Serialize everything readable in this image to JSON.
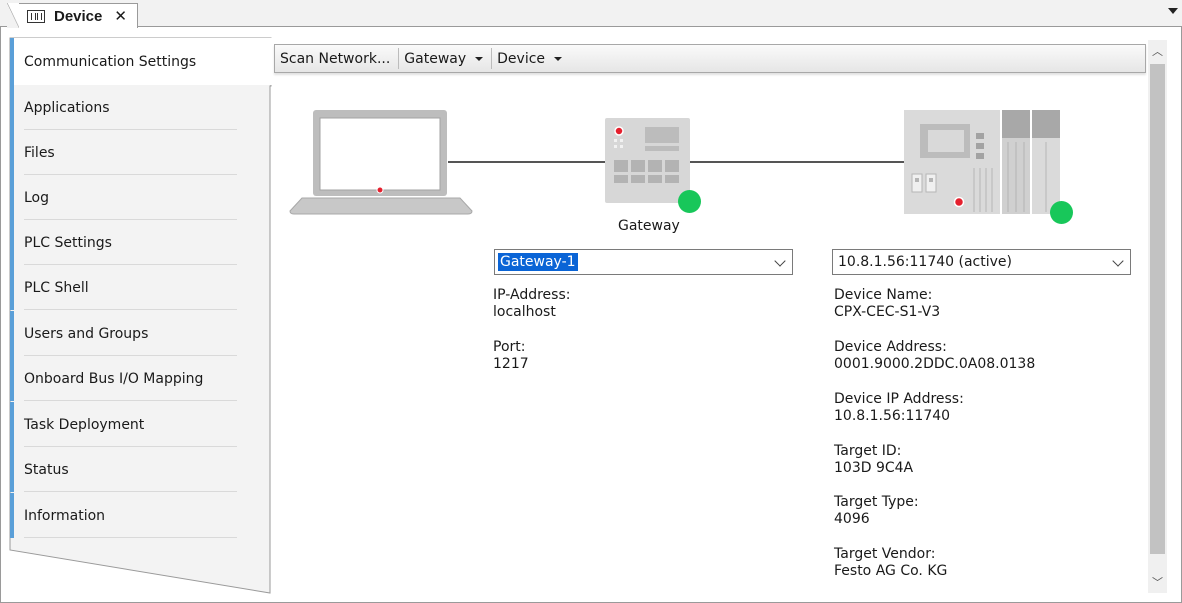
{
  "tab": {
    "title": "Device",
    "close": "✕"
  },
  "toolbar": {
    "scan_label": "Scan Network...",
    "gateway_label": "Gateway",
    "device_label": "Device"
  },
  "nav": {
    "items": [
      {
        "label": "Communication Settings",
        "active": true
      },
      {
        "label": "Applications"
      },
      {
        "label": "Files"
      },
      {
        "label": "Log"
      },
      {
        "label": "PLC Settings"
      },
      {
        "label": "PLC Shell"
      },
      {
        "label": "Users and Groups"
      },
      {
        "label": "Onboard Bus I/O Mapping"
      },
      {
        "label": "Task Deployment"
      },
      {
        "label": "Status"
      },
      {
        "label": "Information"
      }
    ]
  },
  "gateway": {
    "caption": "Gateway",
    "selected": "Gateway-1",
    "ip_label": "IP-Address:",
    "ip_value": "localhost",
    "port_label": "Port:",
    "port_value": "1217"
  },
  "device": {
    "selected": "10.8.1.56:11740 (active)",
    "name_label": "Device Name:",
    "name_value": "CPX-CEC-S1-V3",
    "address_label": "Device Address:",
    "address_value": "0001.9000.2DDC.0A08.0138",
    "ip_label": "Device IP Address:",
    "ip_value": "10.8.1.56:11740",
    "target_id_label": "Target ID:",
    "target_id_value": "103D 9C4A",
    "target_type_label": "Target Type:",
    "target_type_value": "4096",
    "target_vendor_label": "Target Vendor:",
    "target_vendor_value": "Festo AG Co. KG"
  },
  "colors": {
    "status_online": "#18c75a",
    "nav_accent": "#5a9fd8",
    "selection": "#0a64d6"
  }
}
